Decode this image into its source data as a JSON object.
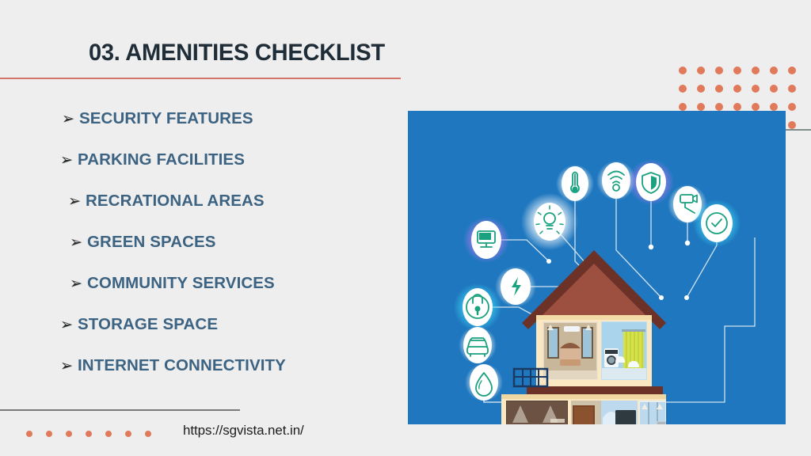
{
  "slide": {
    "title": "03. AMENITIES CHECKLIST",
    "background_color": "#eeeeee",
    "title_color": "#1e2d38",
    "divider_color": "#d4766a",
    "accent_color": "#e07a5a",
    "panel_color": "#1f78bf",
    "list_text_color": "#3d6382"
  },
  "checklist": {
    "bullet_glyph": "➢",
    "items": [
      {
        "label": "SECURITY FEATURES",
        "indent": 78
      },
      {
        "label": "PARKING FACILITIES",
        "indent": 76
      },
      {
        "label": "RECRATIONAL AREAS",
        "indent": 86
      },
      {
        "label": "GREEN SPACES",
        "indent": 88
      },
      {
        "label": "COMMUNITY SERVICES",
        "indent": 88
      },
      {
        "label": "STORAGE SPACE",
        "indent": 76
      },
      {
        "label": "INTERNET CONNECTIVITY",
        "indent": 76
      }
    ]
  },
  "footer": {
    "url": "https://sgvista.net.in/",
    "dot_count": 7
  },
  "decor": {
    "dot_grid_columns": 7,
    "dot_grid_rows": 4
  },
  "illustration": {
    "alt": "smart-home-cutaway-with-iot-icons",
    "icons": [
      {
        "name": "lightning-bolt-icon",
        "glow": "none"
      },
      {
        "name": "lightbulb-icon",
        "glow": "white"
      },
      {
        "name": "thermometer-icon",
        "glow": "none"
      },
      {
        "name": "wifi-icon",
        "glow": "none"
      },
      {
        "name": "shield-icon",
        "glow": "purple"
      },
      {
        "name": "camera-icon",
        "glow": "none"
      },
      {
        "name": "clock-check-icon",
        "glow": "cyan"
      },
      {
        "name": "monitor-icon",
        "glow": "purple"
      },
      {
        "name": "lock-icon",
        "glow": "cyan"
      },
      {
        "name": "car-icon",
        "glow": "none"
      },
      {
        "name": "water-drop-icon",
        "glow": "none"
      }
    ],
    "rooms": [
      "bedroom",
      "bathroom-laundry",
      "garage",
      "entry-hall",
      "living-room",
      "kitchen"
    ]
  }
}
